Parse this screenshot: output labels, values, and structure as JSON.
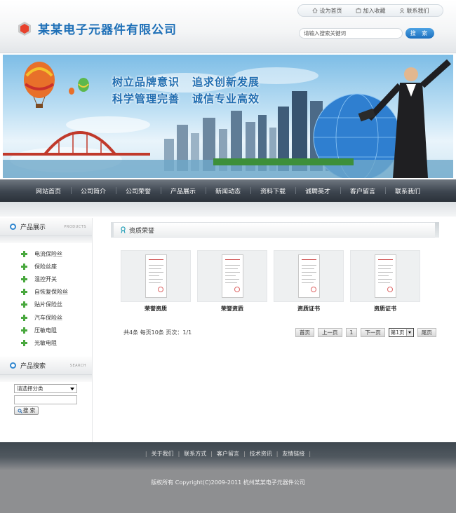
{
  "header": {
    "company_name": "某某电子元器件有限公司",
    "top_links": [
      {
        "label": "设为首页",
        "icon": "home-icon"
      },
      {
        "label": "加入收藏",
        "icon": "bookmark-icon"
      },
      {
        "label": "联系我们",
        "icon": "contact-icon"
      }
    ],
    "search_placeholder": "请输入搜索关键词",
    "search_button": "搜 索"
  },
  "banner": {
    "slogans": [
      "树立品牌意识",
      "追求创新发展",
      "科学管理完善",
      "诚信专业高效"
    ]
  },
  "nav": {
    "items": [
      "网站首页",
      "公司简介",
      "公司荣誉",
      "产品展示",
      "新闻动态",
      "资料下载",
      "诚聘英才",
      "客户留言",
      "联系我们"
    ]
  },
  "sidebar": {
    "products_title": "产品展示",
    "products_en": "PRODUCTS",
    "products": [
      "电流保险丝",
      "保险丝座",
      "温控开关",
      "自恢复保险丝",
      "贴片保险丝",
      "汽车保险丝",
      "压敏电阻",
      "光敏电阻"
    ],
    "search_title": "产品搜索",
    "search_en": "SEARCH",
    "category_select": "请选择分类",
    "search_button": "搜 索"
  },
  "main": {
    "section_title": "资质荣誉",
    "certificates": [
      {
        "label": "荣誉资质"
      },
      {
        "label": "荣誉资质"
      },
      {
        "label": "资质证书"
      },
      {
        "label": "资质证书"
      }
    ],
    "pager_info": "共4条  每页10条  页次：1/1",
    "pager": {
      "first": "首页",
      "prev": "上一页",
      "current": "1",
      "next": "下一页",
      "select": "第1页",
      "last": "尾页"
    }
  },
  "footer": {
    "links": [
      "关于我们",
      "联系方式",
      "客户留言",
      "技术资讯",
      "友情链接"
    ],
    "copyright": "版权所有  Copyright(C)2009-2011 杭州某某电子元器件公司"
  },
  "colors": {
    "brand_blue": "#1d6fb7",
    "nav_dark": "#3d454f",
    "plus_green": "#49a83e",
    "footer_gray": "#8e8f91"
  }
}
